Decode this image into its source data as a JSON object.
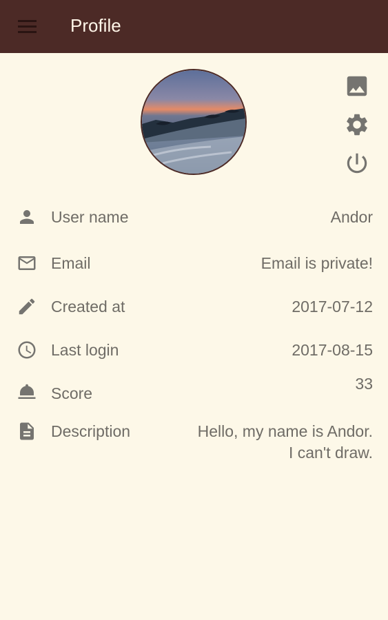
{
  "appbar": {
    "title": "Profile"
  },
  "icons": {
    "menu": "menu-icon",
    "image": "image-icon",
    "settings": "gear-icon",
    "power": "power-icon"
  },
  "colors": {
    "appbar_bg": "#4c2a26",
    "page_bg": "#fdf8e8",
    "text": "#6f6c66",
    "icon": "#757470"
  },
  "profile": {
    "rows": [
      {
        "icon": "person-icon",
        "label": "User name",
        "value": "Andor"
      },
      {
        "icon": "mail-icon",
        "label": "Email",
        "value": "Email is private!"
      },
      {
        "icon": "pencil-icon",
        "label": "Created at",
        "value": "2017-07-12"
      },
      {
        "icon": "clock-icon",
        "label": "Last login",
        "value": "2017-08-15"
      },
      {
        "icon": "bell-icon",
        "label": "Score",
        "value": "33"
      },
      {
        "icon": "document-icon",
        "label": "Description",
        "value": "Hello, my name is Andor.\nI can't draw."
      }
    ]
  }
}
